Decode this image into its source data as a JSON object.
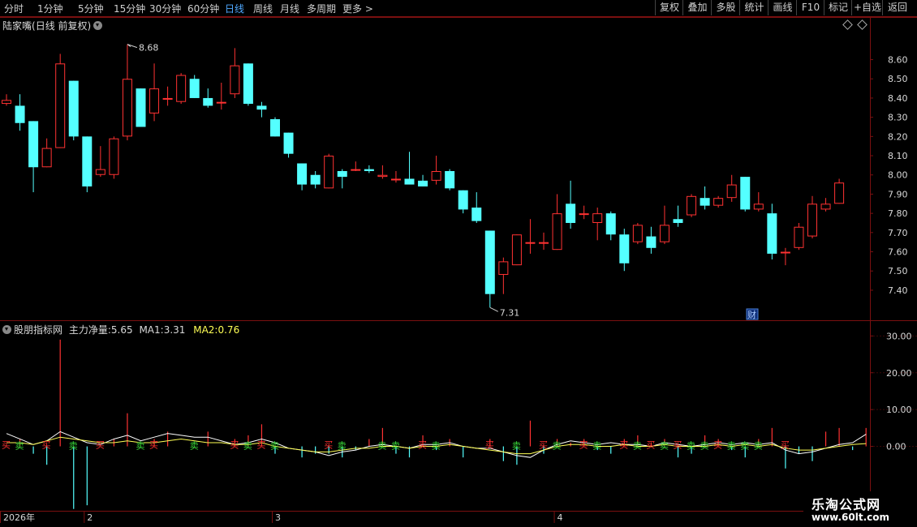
{
  "toolbar": {
    "periods": [
      "分时",
      "1分钟",
      "5分钟",
      "15分钟",
      "30分钟",
      "60分钟",
      "日线",
      "周线",
      "月线",
      "多周期",
      "更多"
    ],
    "active_period": "日线",
    "buttons": [
      "复权",
      "叠加",
      "多股",
      "统计",
      "画线",
      "F10",
      "标记",
      "+自选",
      "返回"
    ]
  },
  "stock": {
    "name": "陆家嘴",
    "mode": "(日线 前复权)"
  },
  "indicator": {
    "source": "股朋指标网",
    "net_label": "主力净量:",
    "net_value": "5.65",
    "ma1_label": "MA1:",
    "ma1_value": "3.31",
    "ma2_label": "MA2:",
    "ma2_value": "0.76"
  },
  "watermark": {
    "line1": "乐淘公式网",
    "line2": "www.60lt.com"
  },
  "colors": {
    "up": "#ff3232",
    "down": "#54ffff",
    "ma1": "#ffffff",
    "ma2": "#ffff55",
    "grid": "#7a1010",
    "buy": "#ff3030",
    "sell": "#38d838"
  },
  "chart_data": [
    {
      "type": "candlestick",
      "price_axis": {
        "ticks": [
          "8.60",
          "8.50",
          "8.40",
          "8.30",
          "8.20",
          "8.10",
          "8.00",
          "7.90",
          "7.80",
          "7.70",
          "7.60",
          "7.50",
          "7.40"
        ],
        "ylim": [
          7.29,
          8.75
        ]
      },
      "max_label": "8.68",
      "min_label": "7.31",
      "marker": "财",
      "candles": [
        {
          "o": 8.37,
          "h": 8.42,
          "l": 8.36,
          "c": 8.39
        },
        {
          "o": 8.36,
          "h": 8.42,
          "l": 8.23,
          "c": 8.27
        },
        {
          "o": 8.28,
          "h": 8.28,
          "l": 7.91,
          "c": 8.04
        },
        {
          "o": 8.04,
          "h": 8.19,
          "l": 8.04,
          "c": 8.14
        },
        {
          "o": 8.14,
          "h": 8.63,
          "l": 8.14,
          "c": 8.58
        },
        {
          "o": 8.49,
          "h": 8.49,
          "l": 8.18,
          "c": 8.2
        },
        {
          "o": 8.2,
          "h": 8.2,
          "l": 7.91,
          "c": 7.94
        },
        {
          "o": 8.0,
          "h": 8.15,
          "l": 7.99,
          "c": 8.03
        },
        {
          "o": 8.0,
          "h": 8.2,
          "l": 7.98,
          "c": 8.19
        },
        {
          "o": 8.2,
          "h": 8.68,
          "l": 8.18,
          "c": 8.5
        },
        {
          "o": 8.45,
          "h": 8.45,
          "l": 8.25,
          "c": 8.25
        },
        {
          "o": 8.32,
          "h": 8.58,
          "l": 8.28,
          "c": 8.45
        },
        {
          "o": 8.4,
          "h": 8.46,
          "l": 8.36,
          "c": 8.4
        },
        {
          "o": 8.38,
          "h": 8.53,
          "l": 8.37,
          "c": 8.52
        },
        {
          "o": 8.5,
          "h": 8.52,
          "l": 8.4,
          "c": 8.4
        },
        {
          "o": 8.4,
          "h": 8.45,
          "l": 8.35,
          "c": 8.36
        },
        {
          "o": 8.38,
          "h": 8.48,
          "l": 8.34,
          "c": 8.38
        },
        {
          "o": 8.42,
          "h": 8.66,
          "l": 8.4,
          "c": 8.57
        },
        {
          "o": 8.58,
          "h": 8.58,
          "l": 8.36,
          "c": 8.37
        },
        {
          "o": 8.36,
          "h": 8.38,
          "l": 8.3,
          "c": 8.34
        },
        {
          "o": 8.29,
          "h": 8.3,
          "l": 8.2,
          "c": 8.2
        },
        {
          "o": 8.22,
          "h": 8.22,
          "l": 8.09,
          "c": 8.11
        },
        {
          "o": 8.06,
          "h": 8.06,
          "l": 7.92,
          "c": 7.95
        },
        {
          "o": 8.0,
          "h": 8.02,
          "l": 7.93,
          "c": 7.95
        },
        {
          "o": 7.93,
          "h": 8.11,
          "l": 7.93,
          "c": 8.1
        },
        {
          "o": 8.02,
          "h": 8.03,
          "l": 7.93,
          "c": 7.99
        },
        {
          "o": 8.03,
          "h": 8.07,
          "l": 8.02,
          "c": 8.03
        },
        {
          "o": 8.03,
          "h": 8.05,
          "l": 8.01,
          "c": 8.02
        },
        {
          "o": 7.99,
          "h": 8.05,
          "l": 7.98,
          "c": 8.0
        },
        {
          "o": 7.98,
          "h": 8.02,
          "l": 7.96,
          "c": 7.98
        },
        {
          "o": 7.98,
          "h": 8.12,
          "l": 7.96,
          "c": 7.95
        },
        {
          "o": 7.97,
          "h": 8.0,
          "l": 7.94,
          "c": 7.94
        },
        {
          "o": 7.97,
          "h": 8.1,
          "l": 7.95,
          "c": 8.02
        },
        {
          "o": 8.02,
          "h": 8.03,
          "l": 7.92,
          "c": 7.93
        },
        {
          "o": 7.92,
          "h": 7.92,
          "l": 7.8,
          "c": 7.82
        },
        {
          "o": 7.83,
          "h": 7.91,
          "l": 7.75,
          "c": 7.76
        },
        {
          "o": 7.71,
          "h": 7.71,
          "l": 7.31,
          "c": 7.38
        },
        {
          "o": 7.48,
          "h": 7.57,
          "l": 7.38,
          "c": 7.55
        },
        {
          "o": 7.53,
          "h": 7.69,
          "l": 7.53,
          "c": 7.69
        },
        {
          "o": 7.65,
          "h": 7.77,
          "l": 7.59,
          "c": 7.65
        },
        {
          "o": 7.65,
          "h": 7.7,
          "l": 7.61,
          "c": 7.65
        },
        {
          "o": 7.61,
          "h": 7.9,
          "l": 7.61,
          "c": 7.8
        },
        {
          "o": 7.85,
          "h": 7.97,
          "l": 7.72,
          "c": 7.75
        },
        {
          "o": 7.8,
          "h": 7.84,
          "l": 7.77,
          "c": 7.8
        },
        {
          "o": 7.75,
          "h": 7.83,
          "l": 7.66,
          "c": 7.8
        },
        {
          "o": 7.8,
          "h": 7.81,
          "l": 7.66,
          "c": 7.69
        },
        {
          "o": 7.69,
          "h": 7.72,
          "l": 7.5,
          "c": 7.54
        },
        {
          "o": 7.65,
          "h": 7.75,
          "l": 7.64,
          "c": 7.74
        },
        {
          "o": 7.68,
          "h": 7.73,
          "l": 7.59,
          "c": 7.62
        },
        {
          "o": 7.65,
          "h": 7.84,
          "l": 7.64,
          "c": 7.74
        },
        {
          "o": 7.77,
          "h": 7.84,
          "l": 7.73,
          "c": 7.75
        },
        {
          "o": 7.79,
          "h": 7.9,
          "l": 7.78,
          "c": 7.89
        },
        {
          "o": 7.88,
          "h": 7.94,
          "l": 7.82,
          "c": 7.84
        },
        {
          "o": 7.84,
          "h": 7.89,
          "l": 7.83,
          "c": 7.88
        },
        {
          "o": 7.88,
          "h": 8.0,
          "l": 7.86,
          "c": 7.95
        },
        {
          "o": 7.99,
          "h": 7.99,
          "l": 7.81,
          "c": 7.82
        },
        {
          "o": 7.82,
          "h": 7.91,
          "l": 7.81,
          "c": 7.85
        },
        {
          "o": 7.8,
          "h": 7.85,
          "l": 7.56,
          "c": 7.59
        },
        {
          "o": 7.6,
          "h": 7.62,
          "l": 7.53,
          "c": 7.6
        },
        {
          "o": 7.62,
          "h": 7.75,
          "l": 7.61,
          "c": 7.73
        },
        {
          "o": 7.68,
          "h": 7.89,
          "l": 7.67,
          "c": 7.85
        },
        {
          "o": 7.82,
          "h": 7.88,
          "l": 7.81,
          "c": 7.85
        },
        {
          "o": 7.85,
          "h": 7.98,
          "l": 7.85,
          "c": 7.96
        }
      ]
    },
    {
      "type": "bar",
      "title": "股朋指标网",
      "y_axis": {
        "ticks": [
          "30.00",
          "20.00",
          "10.00",
          "0.00"
        ],
        "ylim": [
          -17.5,
          32.5
        ]
      },
      "x_labels": [
        "2026年",
        "2",
        "3",
        "4"
      ],
      "x_label_indices": [
        0,
        6,
        20,
        41
      ],
      "series": [
        {
          "name": "主力净量",
          "values": [
            0,
            2,
            -2,
            -5,
            29,
            -17,
            -16,
            0,
            2,
            9,
            0,
            2,
            4,
            0,
            0,
            4,
            0,
            2,
            3,
            6,
            -2,
            0,
            -3,
            -2,
            -2,
            -3,
            -1,
            2,
            5,
            -2,
            -3,
            3,
            -1,
            2,
            -3,
            0,
            2,
            -4,
            -5,
            7,
            -2,
            2,
            1,
            2,
            -1,
            -2,
            2,
            3,
            1,
            2,
            -3,
            -2,
            3,
            2,
            -1,
            -3,
            2,
            5,
            -6,
            -2,
            -4,
            4,
            5,
            -1,
            5
          ]
        },
        {
          "name": "MA1",
          "values": [
            3.5,
            2.0,
            0.5,
            1.5,
            4.0,
            2.5,
            1.0,
            0.5,
            2.0,
            3.0,
            1.5,
            2.5,
            3.5,
            3.0,
            2.5,
            2.5,
            1.5,
            0.5,
            1.0,
            2.0,
            1.0,
            -0.5,
            -1.0,
            -1.5,
            -2.5,
            -1.5,
            -1.0,
            0.0,
            0.5,
            0.0,
            -0.5,
            0.5,
            0.5,
            1.0,
            0.0,
            -0.5,
            -0.5,
            -1.5,
            -2.5,
            -3.0,
            -1.0,
            0.5,
            1.5,
            1.0,
            0.5,
            1.0,
            0.5,
            0.5,
            0.0,
            1.0,
            0.5,
            0.0,
            0.5,
            1.0,
            0.5,
            1.0,
            0.5,
            1.0,
            -1.0,
            -2.0,
            -1.5,
            -0.5,
            0.5,
            1.0,
            3.31
          ]
        },
        {
          "name": "MA2",
          "values": [
            1.0,
            1.0,
            0.5,
            1.5,
            2.5,
            2.0,
            1.5,
            1.0,
            1.0,
            1.5,
            1.0,
            1.0,
            1.5,
            2.0,
            1.5,
            1.0,
            1.0,
            0.5,
            0.5,
            1.0,
            0.0,
            -0.5,
            -1.0,
            -1.5,
            -1.5,
            -1.0,
            -0.5,
            -0.5,
            0.0,
            0.0,
            -0.5,
            0.0,
            0.0,
            0.5,
            0.0,
            -0.5,
            -1.0,
            -1.5,
            -2.0,
            -2.0,
            -1.0,
            0.0,
            0.5,
            0.5,
            0.0,
            0.0,
            0.5,
            0.0,
            0.0,
            0.5,
            0.0,
            0.0,
            0.0,
            0.5,
            0.0,
            0.5,
            0.0,
            0.5,
            -0.5,
            -1.0,
            -1.0,
            -0.5,
            0.0,
            0.5,
            0.76
          ]
        }
      ],
      "signals": [
        {
          "i": 0,
          "t": "买"
        },
        {
          "i": 1,
          "t": "卖"
        },
        {
          "i": 3,
          "t": "买"
        },
        {
          "i": 5,
          "t": "卖"
        },
        {
          "i": 7,
          "t": "买"
        },
        {
          "i": 10,
          "t": "卖"
        },
        {
          "i": 11,
          "t": "买"
        },
        {
          "i": 14,
          "t": "卖"
        },
        {
          "i": 17,
          "t": "买"
        },
        {
          "i": 18,
          "t": "卖"
        },
        {
          "i": 19,
          "t": "买"
        },
        {
          "i": 20,
          "t": "卖"
        },
        {
          "i": 24,
          "t": "买"
        },
        {
          "i": 25,
          "t": "卖"
        },
        {
          "i": 28,
          "t": "卖"
        },
        {
          "i": 29,
          "t": "卖"
        },
        {
          "i": 31,
          "t": "买"
        },
        {
          "i": 32,
          "t": "卖"
        },
        {
          "i": 36,
          "t": "买"
        },
        {
          "i": 38,
          "t": "卖"
        },
        {
          "i": 40,
          "t": "买"
        },
        {
          "i": 41,
          "t": "卖"
        },
        {
          "i": 43,
          "t": "买"
        },
        {
          "i": 44,
          "t": "卖"
        },
        {
          "i": 46,
          "t": "买"
        },
        {
          "i": 47,
          "t": "卖"
        },
        {
          "i": 48,
          "t": "买"
        },
        {
          "i": 49,
          "t": "卖"
        },
        {
          "i": 50,
          "t": "买"
        },
        {
          "i": 51,
          "t": "卖"
        },
        {
          "i": 52,
          "t": "卖"
        },
        {
          "i": 53,
          "t": "买"
        },
        {
          "i": 54,
          "t": "卖"
        },
        {
          "i": 55,
          "t": "卖"
        },
        {
          "i": 56,
          "t": "卖"
        },
        {
          "i": 58,
          "t": "买"
        }
      ]
    }
  ]
}
